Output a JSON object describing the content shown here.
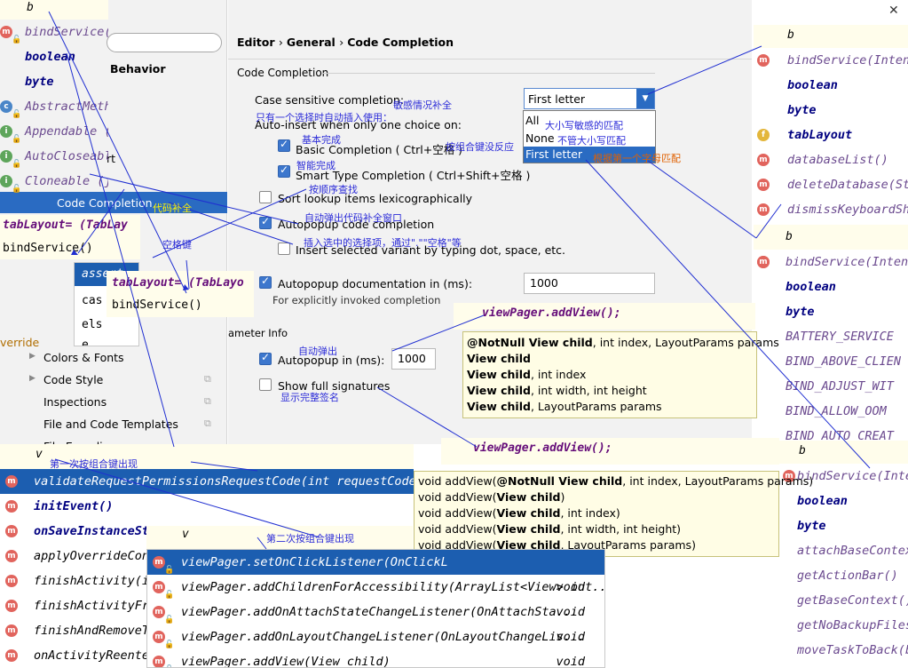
{
  "breadcrumb": {
    "part1": "Editor",
    "part2": "General",
    "part3": "Code Completion"
  },
  "left_nav": {
    "behavior": "Behavior",
    "rt": "rt",
    "selected": "Code Completion",
    "items": [
      "Colors & Fonts",
      "Code Style",
      "Inspections",
      "File and Code Templates",
      "File Encodings"
    ],
    "override": "verride"
  },
  "section_title": "Code Completion",
  "case_label": "Case sensitive completion:",
  "case_value": "First letter",
  "case_options": [
    "All",
    "None",
    "First letter"
  ],
  "auto_insert_label": "Auto-insert when only one choice on:",
  "basic_completion": "Basic Completion ( Ctrl+空格 )",
  "smart_completion": "Smart Type Completion ( Ctrl+Shift+空格 )",
  "sort_lookup": "Sort lookup items lexicographically",
  "autopopup_completion": "Autopopup code completion",
  "insert_selected": "Insert selected variant by typing dot, space, etc.",
  "autopopup_doc": "Autopopup documentation in (ms):",
  "autopopup_doc_value": "1000",
  "explicit_note": "For explicitly invoked completion",
  "param_info": "ameter Info",
  "autopopup_in": "Autopopup in (ms):",
  "autopopup_in_value": "1000",
  "show_full_sig": "Show full signatures",
  "annotations": {
    "case_sensitive": "敏感情况补全",
    "only_one": "只有一个选择时自动插入使用：",
    "basic": "基本完成",
    "combo_no_response": "按组合键没反应",
    "smart": "智能完成",
    "order_find": "按顺序查找",
    "code_completion": "代码补全",
    "auto_popup_window": "自动弹出代码补全窗口",
    "insert_selected": "插入选中的选择项，通过\".\"\"空格\"等",
    "space_key": "空格键",
    "auto_popup": "自动弹出",
    "show_full": "显示完整签名",
    "case_all": "大小写敏感的匹配",
    "case_none": "不管大小写匹配",
    "case_first": "根据第一个字母匹配",
    "first_combo": "第一次按组合键出现",
    "second_combo": "第二次按组合键出现"
  },
  "top_left_popup": {
    "typed": "b",
    "rows": [
      {
        "icon": "m",
        "text": "bindService(Int",
        "lock": true
      },
      {
        "icon": "",
        "text": "boolean",
        "bold": true
      },
      {
        "icon": "",
        "text": "byte",
        "bold": true
      },
      {
        "icon": "c",
        "text": "AbstractMeth",
        "lock": true
      },
      {
        "icon": "i",
        "text": "Appendable (",
        "lock": true
      },
      {
        "icon": "i",
        "text": "AutoCloseable",
        "lock": true
      },
      {
        "icon": "i",
        "text": "Cloneable (java",
        "lock": true
      }
    ]
  },
  "code_snippet_1": {
    "line1": "tabLayout= (TabLay",
    "line2": "bindService()"
  },
  "snippet1_popup": [
    "assert",
    "cas",
    "els",
    "e"
  ],
  "code_snippet_2": {
    "line1": "tabLayout= (TabLayo",
    "line2": "bindService()"
  },
  "right_popup_1": {
    "typed": "b",
    "rows": [
      {
        "icon": "m",
        "text": "bindService(Intent"
      },
      {
        "icon": "",
        "text": "boolean",
        "bold": true
      },
      {
        "icon": "",
        "text": "byte",
        "bold": true
      },
      {
        "icon": "f",
        "text": "tabLayout",
        "bold": true
      },
      {
        "icon": "m",
        "text": "databaseList()"
      },
      {
        "icon": "m",
        "text": "deleteDatabase(Str"
      },
      {
        "icon": "m",
        "text": "dismissKeyboardSho"
      }
    ]
  },
  "right_popup_2": {
    "typed": "b",
    "rows": [
      {
        "icon": "m",
        "text": "bindService(Intent s"
      },
      {
        "icon": "",
        "text": "boolean",
        "bold": true
      },
      {
        "icon": "",
        "text": "byte",
        "bold": true
      },
      {
        "icon": "",
        "text": "BATTERY_SERVICE"
      },
      {
        "icon": "",
        "text": "BIND_ABOVE_CLIEN"
      },
      {
        "icon": "",
        "text": "BIND_ADJUST_WIT"
      },
      {
        "icon": "",
        "text": "BIND_ALLOW_OOM"
      },
      {
        "icon": "",
        "text": "BIND_AUTO_CREAT"
      }
    ]
  },
  "right_popup_3": {
    "typed": "b",
    "rows": [
      {
        "icon": "",
        "text": "bindService(Intent"
      },
      {
        "icon": "",
        "text": "boolean",
        "bold": true
      },
      {
        "icon": "",
        "text": "byte",
        "bold": true
      },
      {
        "icon": "",
        "text": "attachBaseContext"
      },
      {
        "icon": "",
        "text": "getActionBar()"
      },
      {
        "icon": "",
        "text": "getBaseContext()"
      },
      {
        "icon": "",
        "text": "getNoBackupFilesD"
      },
      {
        "icon": "",
        "text": "moveTaskToBack(b"
      }
    ]
  },
  "viewpager_hint_1": {
    "code": "viewPager.addView();",
    "rows": [
      {
        "bold": "@NotNull View child",
        "rest": ", int index, LayoutParams params"
      },
      {
        "bold": "View child",
        "rest": ""
      },
      {
        "bold": "View child",
        "rest": ", int index"
      },
      {
        "bold": "View child",
        "rest": ", int width, int height"
      },
      {
        "bold": "View child",
        "rest": ", LayoutParams params"
      }
    ]
  },
  "viewpager_hint_2": {
    "code": "viewPager.addView();",
    "rows": [
      {
        "pre": "void addView(",
        "bold": "@NotNull View child",
        "rest": ", int index, LayoutParams params)"
      },
      {
        "pre": "void addView(",
        "bold": "View child",
        "rest": ")"
      },
      {
        "pre": "void addView(",
        "bold": "View child",
        "rest": ", int index)"
      },
      {
        "pre": "void addView(",
        "bold": "View child",
        "rest": ", int width, int height)"
      },
      {
        "pre": "void addView(",
        "bold": "View child",
        "rest": ", LayoutParams params)"
      }
    ]
  },
  "bottom_left_popup": {
    "typed": "v",
    "rows": [
      {
        "icon": "m",
        "text": "validateRequestPermissionsRequestCode(int requestCode)",
        "sel": true
      },
      {
        "icon": "m",
        "text": "initEvent()",
        "bold": true
      },
      {
        "icon": "m",
        "text": "onSaveInstanceState(Bundle outState)",
        "bold": true
      },
      {
        "icon": "m",
        "text": "applyOverrideConfi"
      },
      {
        "icon": "m",
        "text": "finishActivity(int"
      },
      {
        "icon": "m",
        "text": "finishActivityFrom"
      },
      {
        "icon": "m",
        "text": "finishAndRemoveTa"
      },
      {
        "icon": "m",
        "text": "onActivityReenter("
      }
    ]
  },
  "bottom_popup": {
    "typed": "v",
    "rows": [
      {
        "text": "viewPager.setOnClickListener(OnClickL",
        "ret": "",
        "sel": true
      },
      {
        "text": "viewPager.addChildrenForAccessibility(ArrayList<View> out...",
        "ret": "void"
      },
      {
        "text": "viewPager.addOnAttachStateChangeListener(OnAttachSta...",
        "ret": "void"
      },
      {
        "text": "viewPager.addOnLayoutChangeListener(OnLayoutChangeLis...",
        "ret": "void"
      },
      {
        "text": "viewPager.addView(View child)",
        "ret": "void"
      }
    ]
  },
  "close_glyph": "✕"
}
